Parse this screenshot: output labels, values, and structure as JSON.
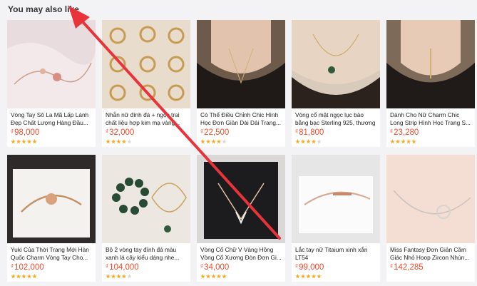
{
  "section": {
    "title": "You may also like"
  },
  "currency_symbol": "₫",
  "colors": {
    "price": "#f24b2c",
    "star": "#f7a81b",
    "annotation_arrow": "#e8333a"
  },
  "products": [
    {
      "name": "Vòng Tay Sô La Mã Lấp Lánh Đẹp Chất Lượng Hàng Đầu...",
      "price": "98,000",
      "rating": 5
    },
    {
      "name": "Nhẫn nữ đính đá + ngọc trai chất liệu hợp kim mạ vàng...",
      "price": "32,000",
      "rating": 4
    },
    {
      "name": "Có Thể Điều Chỉnh Chic Hình Học Đơn Giản Dài Dải Trang...",
      "price": "22,500",
      "rating": 4
    },
    {
      "name": "Vòng cổ mặt ngọc lục bảo bằng bạc Sterling 925, thương hiệ...",
      "price": "81,800",
      "rating": 4
    },
    {
      "name": "Dành Cho Nữ Charm Chic Long Strip Hình Học Trang S...",
      "price": "23,280",
      "rating": 5
    },
    {
      "name": "Yuki Của Thời Trang Mới Hàn Quốc Charm Vòng Tay Cho...",
      "price": "102,000",
      "rating": 5
    },
    {
      "name": "Bộ 2 vòng tay đính đá màu xanh lá cây kiểu dáng nhe...",
      "price": "104,000",
      "rating": 4
    },
    {
      "name": "Vòng Cổ Chữ V Vàng Hồng Vòng Cổ Xương Đòn Đơn Gi...",
      "price": "34,000",
      "rating": 5
    },
    {
      "name": "Lắc tay nữ Titaium xinh xắn LT54",
      "price": "99,000",
      "rating": 5
    },
    {
      "name": "Miss Fantasy Đơn Giản Cầm Giác Nhỏ Hoop Zircon Nhún...",
      "price": "142,285",
      "rating": 0
    }
  ]
}
